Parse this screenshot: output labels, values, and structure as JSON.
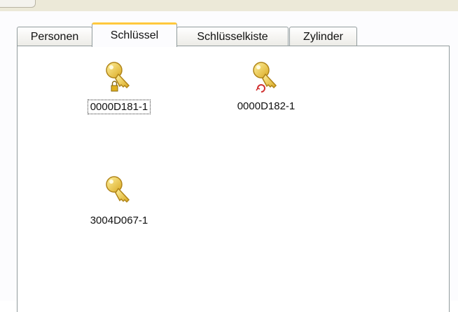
{
  "tabs": [
    {
      "label": "Personen"
    },
    {
      "label": "Schlüssel"
    },
    {
      "label": "Schlüsselkiste"
    },
    {
      "label": "Zylinder"
    }
  ],
  "active_tab": "Schlüssel",
  "items": [
    {
      "label": "0000D181-1",
      "icon": "key-lock-icon",
      "selected": true
    },
    {
      "label": "0000D182-1",
      "icon": "key-refresh-icon",
      "selected": false
    },
    {
      "label": "3004D067-1",
      "icon": "key-icon",
      "selected": false
    }
  ],
  "colors": {
    "key_gold": "#e8c030",
    "active_tab_accent": "#ffc83c",
    "tab_border": "#919b9c"
  }
}
